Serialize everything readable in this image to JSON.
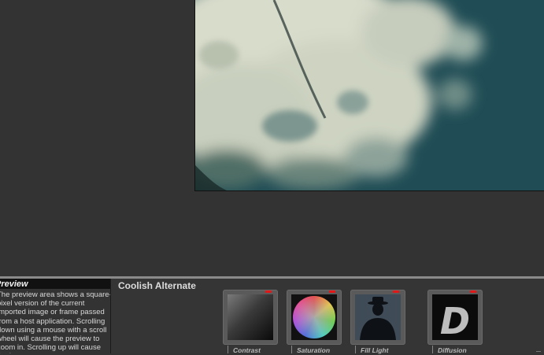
{
  "help": {
    "title": "Preview",
    "text": "The preview area shows a square-pixel version of the current imported image or frame passed from a host application. Scrolling down using a mouse with a scroll wheel will cause the preview to zoom in. Scrolling up will cause the image"
  },
  "filter": {
    "name": "Coolish Alternate"
  },
  "tools": [
    {
      "label": "Contrast",
      "icon": "contrast-gradient-icon"
    },
    {
      "label": "Saturation",
      "icon": "color-wheel-icon"
    },
    {
      "label": "Fill Light",
      "icon": "silhouette-icon"
    },
    {
      "label": "Diffusion",
      "icon": "letter-d-icon"
    }
  ],
  "colors": {
    "background": "#333333",
    "active_indicator": "#e21818",
    "sky_teal": "#1f4c55",
    "cloud": "#d9dccb"
  }
}
